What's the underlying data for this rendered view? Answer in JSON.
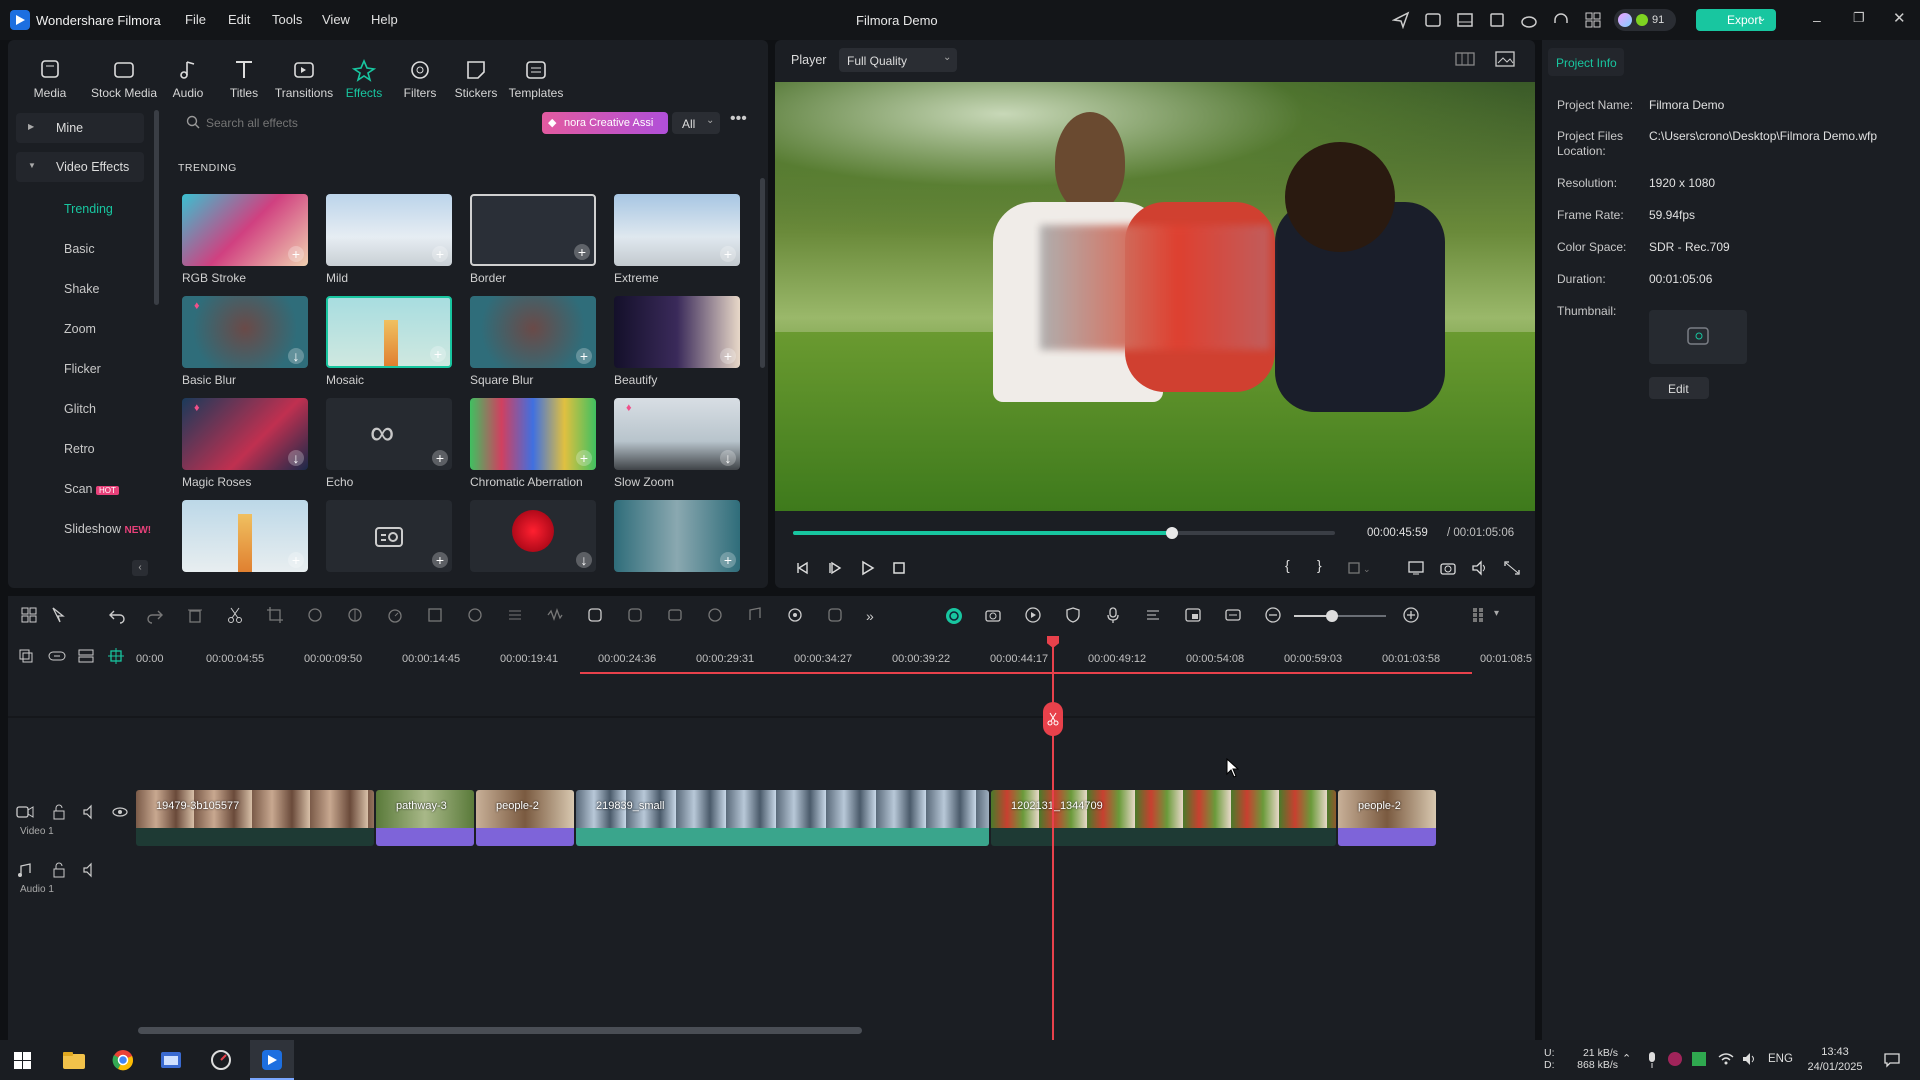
{
  "app": {
    "name": "Wondershare Filmora",
    "title": "Filmora Demo",
    "credits": "91",
    "export_label": "Export"
  },
  "menu": [
    "File",
    "Edit",
    "Tools",
    "View",
    "Help"
  ],
  "lib_tabs": [
    "Media",
    "Stock Media",
    "Audio",
    "Titles",
    "Transitions",
    "Effects",
    "Filters",
    "Stickers",
    "Templates"
  ],
  "sidebar": {
    "mine": "Mine",
    "video_effects": "Video Effects",
    "items": [
      "Trending",
      "Basic",
      "Shake",
      "Zoom",
      "Flicker",
      "Glitch",
      "Retro",
      "Scan",
      "Slideshow"
    ],
    "scan_badge": "HOT",
    "slideshow_badge": "NEW!"
  },
  "search": {
    "placeholder": "Search all effects",
    "ai_label": "nora Creative Assi",
    "filter": "All"
  },
  "section_title": "TRENDING",
  "effects": [
    "RGB Stroke",
    "Mild",
    "Border",
    "Extreme",
    "Basic Blur",
    "Mosaic",
    "Square Blur",
    "Beautify",
    "Magic Roses",
    "Echo",
    "Chromatic Aberration",
    "Slow Zoom"
  ],
  "player": {
    "label": "Player",
    "quality": "Full Quality",
    "current": "00:00:45:59",
    "total": "/ 00:01:05:06",
    "progress": 0.7
  },
  "project_info": {
    "tab": "Project Info",
    "rows": [
      {
        "k": "Project Name:",
        "v": "Filmora Demo"
      },
      {
        "k": "Project Files Location:",
        "v": "C:\\Users\\crono\\Desktop\\Filmora Demo.wfp"
      },
      {
        "k": "Resolution:",
        "v": "1920 x 1080"
      },
      {
        "k": "Frame Rate:",
        "v": "59.94fps"
      },
      {
        "k": "Color Space:",
        "v": "SDR - Rec.709"
      },
      {
        "k": "Duration:",
        "v": "00:01:05:06"
      }
    ],
    "thumbnail_label": "Thumbnail:",
    "edit_label": "Edit"
  },
  "ruler": [
    "00:00",
    "00:00:04:55",
    "00:00:09:50",
    "00:00:14:45",
    "00:00:19:41",
    "00:00:24:36",
    "00:00:29:31",
    "00:00:34:27",
    "00:00:39:22",
    "00:00:44:17",
    "00:00:49:12",
    "00:00:54:08",
    "00:00:59:03",
    "00:01:03:58",
    "00:01:08:5"
  ],
  "tracks": {
    "video": "Video 1",
    "audio": "Audio 1"
  },
  "clips": [
    "19479-3b105577",
    "pathway-3",
    "people-2",
    "219839_small",
    "1202131_1344709",
    "people-2"
  ],
  "taskbar": {
    "up": "21 kB/s",
    "down": "868 kB/s",
    "up_label": "U:",
    "down_label": "D:",
    "lang": "ENG",
    "time": "13:43",
    "date": "24/01/2025"
  },
  "colors": {
    "accent": "#18c6a0",
    "playhead": "#e8414b",
    "clip_purple": "#7e64d9",
    "clip_teal": "#3aa58c"
  }
}
